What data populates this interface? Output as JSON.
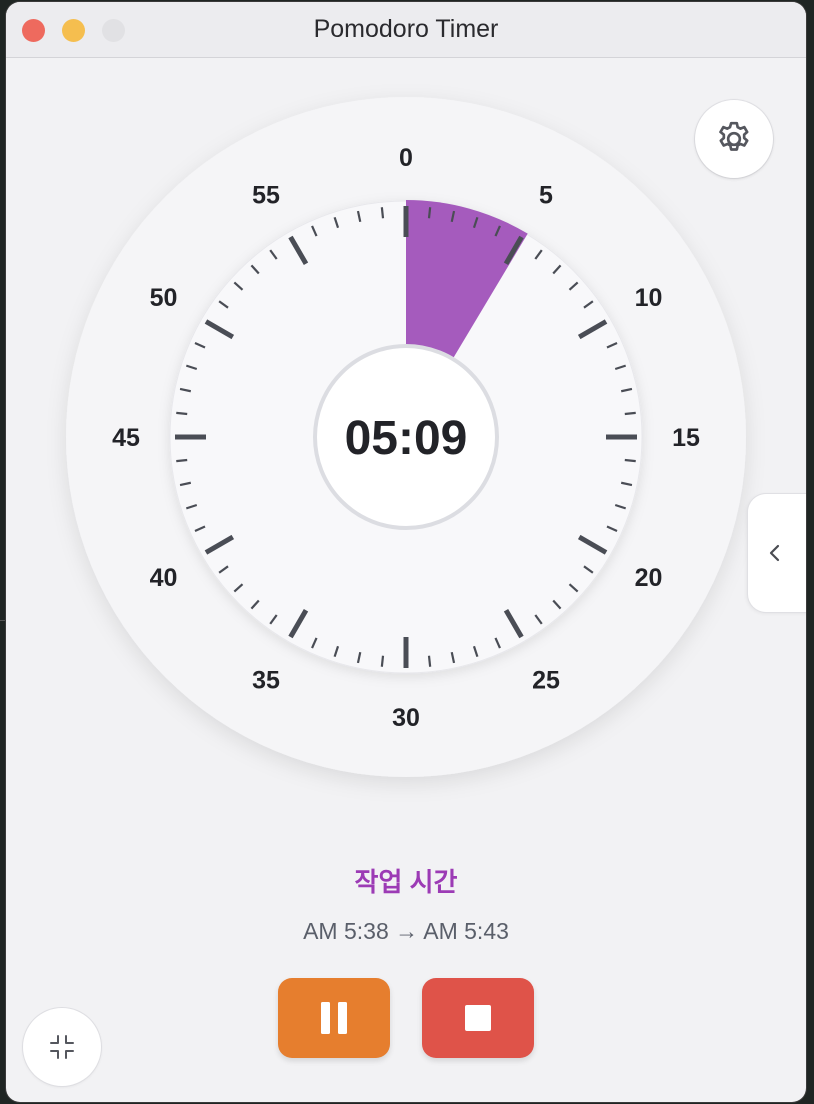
{
  "window": {
    "title": "Pomodoro Timer"
  },
  "timer": {
    "display": "05:09",
    "elapsed_minutes": 5.15,
    "dial_labels": [
      "0",
      "5",
      "10",
      "15",
      "20",
      "25",
      "30",
      "35",
      "40",
      "45",
      "50",
      "55"
    ],
    "progress_color": "#a55bbd"
  },
  "session": {
    "mode_label": "작업 시간",
    "mode_color": "#9c3bb5",
    "time_range": "AM 5:38 → AM 5:43"
  },
  "controls": {
    "pause_color": "#e67e2e",
    "stop_color": "#df5349"
  },
  "icons": {
    "settings": "gear-icon",
    "side_panel": "chevron-left-icon",
    "minimize": "collapse-icon",
    "pause": "pause-icon",
    "stop": "stop-icon"
  }
}
